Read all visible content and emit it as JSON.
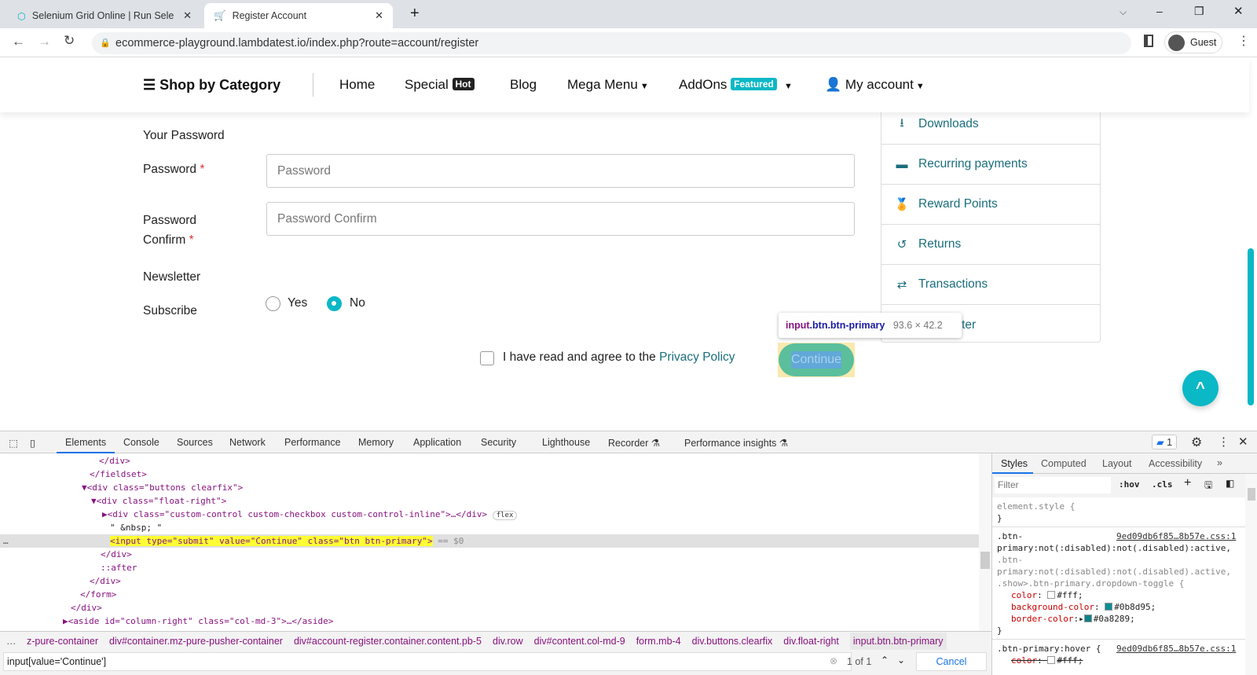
{
  "browser": {
    "tabs": [
      {
        "title": "Selenium Grid Online | Run Selen",
        "active": false
      },
      {
        "title": "Register Account",
        "active": true
      }
    ],
    "url": "ecommerce-playground.lambdatest.io/index.php?route=account/register",
    "profile": "Guest"
  },
  "header": {
    "shop_by_category": "Shop by Category",
    "home": "Home",
    "special": "Special",
    "hot": "Hot",
    "blog": "Blog",
    "mega_menu": "Mega Menu",
    "addons": "AddOns",
    "featured": "Featured",
    "my_account": "My account",
    "brand_color": "#0bb8c6"
  },
  "form": {
    "section_password": "Your Password",
    "password_label": "Password",
    "password_placeholder": "Password",
    "confirm_label_1": "Password",
    "confirm_label_2": "Confirm",
    "confirm_placeholder": "Password Confirm",
    "required": "*",
    "newsletter": "Newsletter",
    "subscribe": "Subscribe",
    "yes": "Yes",
    "no": "No",
    "selected": "No",
    "agree_text": "I have read and agree to the",
    "privacy": "Privacy Policy",
    "continue": "Continue"
  },
  "sidebar": {
    "items": [
      "Downloads",
      "Recurring payments",
      "Reward Points",
      "Returns",
      "Transactions",
      "Newsletter"
    ]
  },
  "tooltip": {
    "selector_tag": "input",
    "selector_class": ".btn.btn-primary",
    "size": "93.6 × 42.2"
  },
  "devtools": {
    "tabs": [
      "Elements",
      "Console",
      "Sources",
      "Network",
      "Performance",
      "Memory",
      "Application",
      "Security",
      "Lighthouse",
      "Recorder",
      "Performance insights"
    ],
    "issues_count": "1",
    "dom": [
      "</div>",
      "</fieldset>",
      "<div class=\"buttons clearfix\">",
      "<div class=\"float-right\">",
      "<div class=\"custom-control custom-checkbox custom-control-inline\">…</div>",
      "\" &nbsp; \"",
      "<input type=\"submit\" value=\"Continue\" class=\"btn btn-primary\">",
      "</div>",
      "::after",
      "</div>",
      "</form>",
      "</div>",
      "<aside id=\"column-right\" class=\"col-md-3\">…</aside>"
    ],
    "flex_badge": "flex",
    "selected_suffix": "== $0",
    "breadcrumbs": [
      "z-pure-container",
      "div#container.mz-pure-pusher-container",
      "div#account-register.container.content.pb-5",
      "div.row",
      "div#content.col-md-9",
      "form.mb-4",
      "div.buttons.clearfix",
      "div.float-right",
      "input.btn.btn-primary"
    ],
    "search_value": "input[value='Continue']",
    "search_count": "1 of 1",
    "cancel": "Cancel",
    "styles_tabs": [
      "Styles",
      "Computed",
      "Layout",
      "Accessibility"
    ],
    "filter_placeholder": "Filter",
    "hov": ":hov",
    "cls": ".cls",
    "styles": {
      "element_style": "element.style {",
      "close": "}",
      "source": "9ed09db6f85…8b57e.css:1",
      "rule1_selector": [
        ".btn-",
        "primary:not(:disabled):not(.disabled):active,",
        ".btn-",
        "primary:not(:disabled):not(.disabled).active,",
        ".show>.btn-primary.dropdown-toggle {"
      ],
      "rule1_props": [
        {
          "name": "color",
          "value": "#fff;"
        },
        {
          "name": "background-color",
          "value": "#0b8d95;"
        },
        {
          "name": "border-color",
          "value": "#0a8289;"
        }
      ],
      "rule2_selector": ".btn-primary:hover {",
      "rule2_prop": {
        "name": "color",
        "value": "#fff;"
      }
    }
  }
}
